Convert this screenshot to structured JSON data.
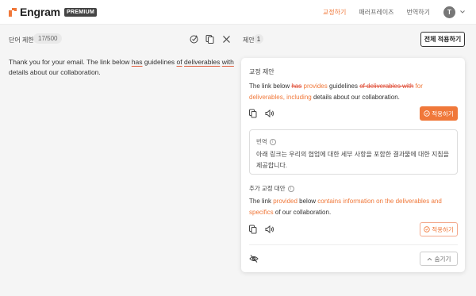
{
  "header": {
    "logo_text": "Engram",
    "badge": "PREMIUM",
    "nav": [
      "교정하기",
      "패러프레이즈",
      "번역하기"
    ],
    "user_initial": "T"
  },
  "toolbar": {
    "word_limit_label": "단어 제한",
    "word_count": "17/500",
    "suggestions_label": "제안",
    "suggestions_count": "1",
    "apply_all_label": "전체 적용하기"
  },
  "editor": {
    "segments": [
      {
        "text": "Thank you for your email. The link below "
      },
      {
        "text": "has",
        "u": true
      },
      {
        "text": " guidelines "
      },
      {
        "text": "of",
        "u": true
      },
      {
        "text": " "
      },
      {
        "text": "deliverables",
        "u": true
      },
      {
        "text": " "
      },
      {
        "text": "with",
        "u": true
      },
      {
        "text": " details about our collaboration."
      }
    ]
  },
  "panel": {
    "title": "교정 제안",
    "suggestion_segments": [
      {
        "text": "The link below "
      },
      {
        "text": "has",
        "t": "del"
      },
      {
        "text": " "
      },
      {
        "text": "provides",
        "t": "ins"
      },
      {
        "text": " guidelines "
      },
      {
        "text": "of deliverables with",
        "t": "del"
      },
      {
        "text": " "
      },
      {
        "text": "for deliverables, including",
        "t": "ins"
      },
      {
        "text": " details about our collaboration."
      }
    ],
    "apply_label": "적용하기",
    "translation_label": "번역",
    "translation_text": "아래 링크는 우리의 협업에 대한 세부 사항을 포함한 결과물에 대한 지침을 제공합니다.",
    "alt_label": "추가 교정 대안",
    "alt_segments": [
      {
        "text": "The link "
      },
      {
        "text": "provided",
        "t": "ins"
      },
      {
        "text": " below "
      },
      {
        "text": "contains information on the deliverables and specifics",
        "t": "ins"
      },
      {
        "text": " of our collaboration."
      }
    ],
    "alt_apply_label": "적용하기",
    "collapse_label": "숨기기"
  },
  "colors": {
    "accent": "#f0783a",
    "deletion": "#e0503a"
  }
}
